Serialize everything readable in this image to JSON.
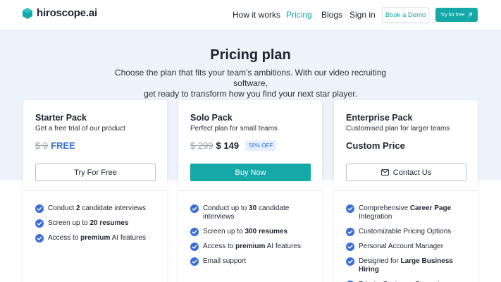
{
  "brand": {
    "name": "hiroscope.ai",
    "accent": "#14a8a8"
  },
  "nav": {
    "links": [
      "How it works",
      "Pricing",
      "Blogs",
      "Sign in"
    ],
    "active": "Pricing",
    "demo_label": "Book a Demo",
    "try_label": "Try for free",
    "try_icon": "arrow-up-right-icon"
  },
  "hero": {
    "title": "Pricing plan",
    "subtitle_line1": "Choose the plan that fits your team's ambitions. With our video recruiting software,",
    "subtitle_line2": "get ready to transform how you find your next star player."
  },
  "plans": [
    {
      "name": "Starter Pack",
      "desc": "Get a free trial of our product",
      "price_old": "$ 9",
      "price_new": "FREE",
      "button": "Try For Free",
      "features": [
        {
          "pre": "Conduct ",
          "bold": "2",
          "post": " candidate interviews"
        },
        {
          "pre": "Screen up to ",
          "bold": "20 resumes",
          "post": ""
        },
        {
          "pre": "Access to ",
          "bold": "premium",
          "post": " AI features"
        }
      ]
    },
    {
      "name": "Solo Pack",
      "desc": "Perfect plan for small teams",
      "price_old": "$ 299",
      "price_new": "$ 149",
      "badge": "50% OFF",
      "button": "Buy Now",
      "features": [
        {
          "pre": "Conduct up to ",
          "bold": "30",
          "post": " candidate interviews"
        },
        {
          "pre": "Screen up to ",
          "bold": "300 resumes",
          "post": ""
        },
        {
          "pre": "Access to ",
          "bold": "premium",
          "post": " AI features"
        },
        {
          "pre": "Email support",
          "bold": "",
          "post": ""
        }
      ]
    },
    {
      "name": "Enterprise Pack",
      "desc": "Customised plan for larger teams",
      "price_custom": "Custom Price",
      "button": "Contact Us",
      "button_icon": "mail-icon",
      "features": [
        {
          "pre": "Comprehensive ",
          "bold": "Career Page",
          "post": " Integration"
        },
        {
          "pre": "Customizable Pricing Options",
          "bold": "",
          "post": ""
        },
        {
          "pre": "Personal Account Manager",
          "bold": "",
          "post": ""
        },
        {
          "pre": "Designed for ",
          "bold": "Large Business Hiring",
          "post": ""
        },
        {
          "pre": "Priority Customer Support",
          "bold": "",
          "post": ""
        }
      ]
    }
  ],
  "colors": {
    "check": "#3b6fd6",
    "hero_bg": "#eef3fa",
    "free": "#3b6fd6"
  }
}
